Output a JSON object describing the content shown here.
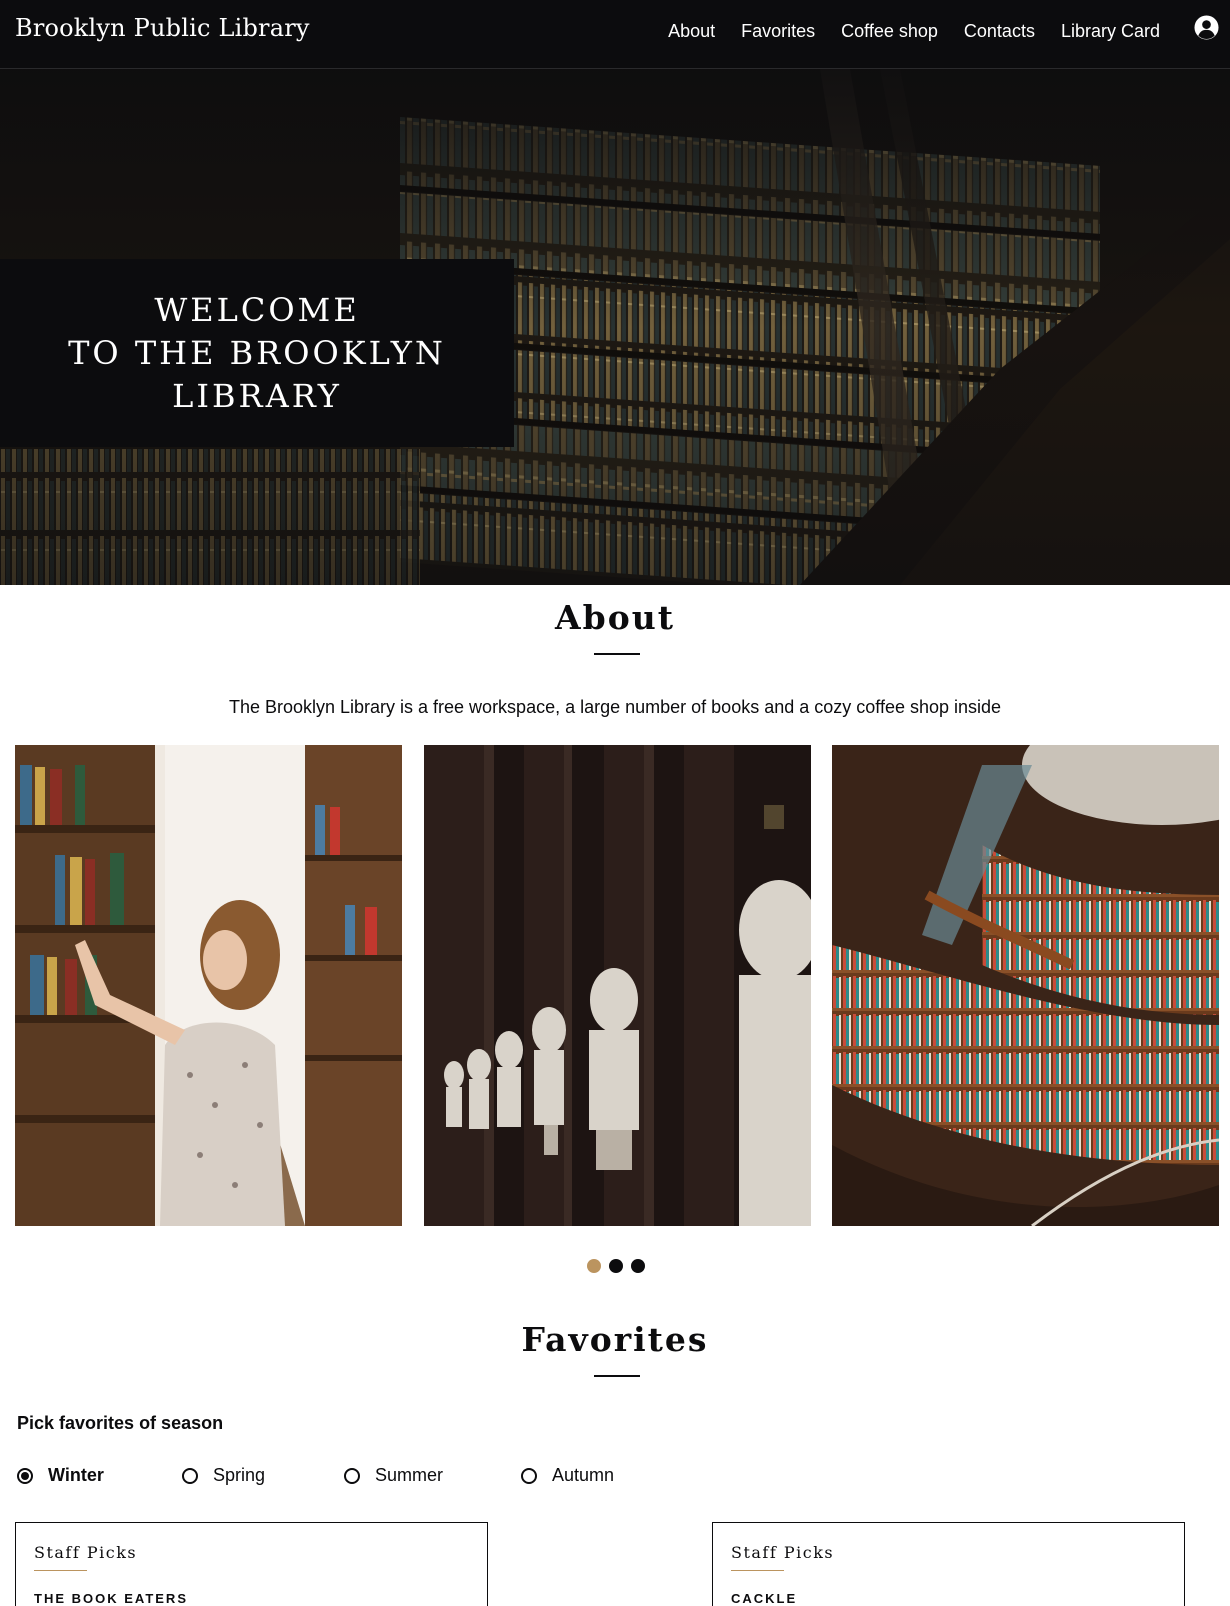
{
  "header": {
    "logo": "Brooklyn Public Library",
    "nav": [
      "About",
      "Favorites",
      "Coffee shop",
      "Contacts",
      "Library Card"
    ],
    "profile_icon": "user-circle-icon"
  },
  "hero": {
    "welcome": "WELCOME\nTO THE BROOKLYN\nLIBRARY"
  },
  "about": {
    "title": "About",
    "description": "The Brooklyn Library is a free workspace, a large number of books and a cozy coffee shop inside",
    "gallery": [
      "woman-browsing-bookshelf-image",
      "marble-busts-hall-image",
      "curved-library-shelves-image"
    ],
    "slider_dots": 3,
    "active_dot": 0
  },
  "favorites": {
    "title": "Favorites",
    "pick_label": "Pick favorites of season",
    "seasons": [
      "Winter",
      "Spring",
      "Summer",
      "Autumn"
    ],
    "selected_season": "Winter",
    "cards": [
      {
        "label": "Staff Picks",
        "book": "THE BOOK EATERS"
      },
      {
        "label": "Staff Picks",
        "book": "CACKLE"
      }
    ]
  },
  "colors": {
    "dark": "#0c0c0e",
    "accent": "#bb945f",
    "white": "#ffffff"
  }
}
